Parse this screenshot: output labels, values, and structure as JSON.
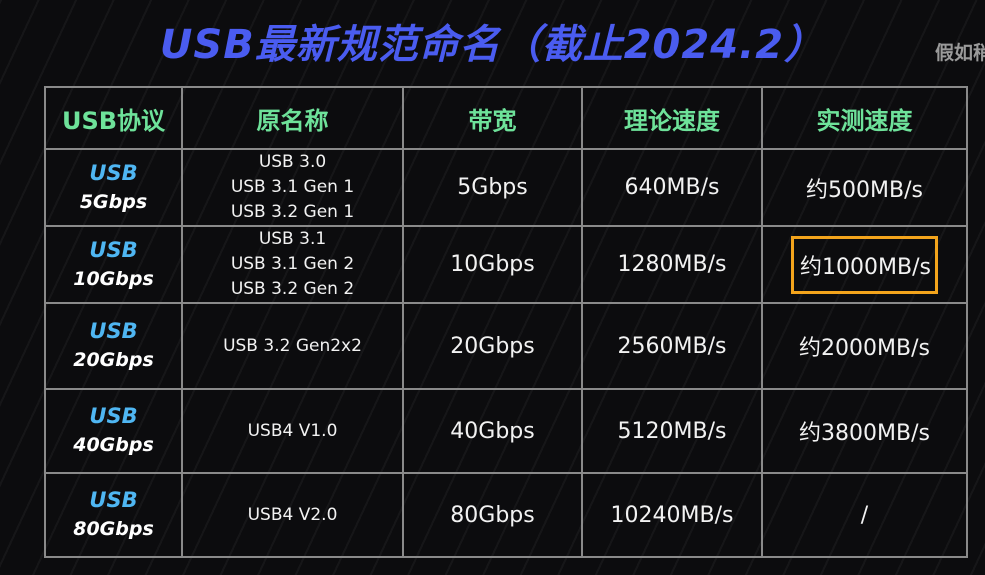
{
  "title": "USB最新规范命名（截止2024.2）",
  "corner_text": "假如稍",
  "colors": {
    "title": "#4a5cf0",
    "header": "#6ee29a",
    "protocol_top": "#4fb6f2",
    "highlight_border": "#f3a41c"
  },
  "headers": [
    "USB协议",
    "原名称",
    "带宽",
    "理论速度",
    "实测速度"
  ],
  "rows": [
    {
      "protocol": [
        "USB",
        "5Gbps"
      ],
      "names": [
        "USB 3.0",
        "USB 3.1 Gen 1",
        "USB 3.2 Gen 1"
      ],
      "bandwidth": "5Gbps",
      "theoretical": "640MB/s",
      "measured": "约500MB/s"
    },
    {
      "protocol": [
        "USB",
        "10Gbps"
      ],
      "names": [
        "USB 3.1",
        "USB 3.1 Gen 2",
        "USB 3.2 Gen 2"
      ],
      "bandwidth": "10Gbps",
      "theoretical": "1280MB/s",
      "measured": "约1000MB/s"
    },
    {
      "protocol": [
        "USB",
        "20Gbps"
      ],
      "names": [
        "USB 3.2 Gen2x2"
      ],
      "bandwidth": "20Gbps",
      "theoretical": "2560MB/s",
      "measured": "约2000MB/s"
    },
    {
      "protocol": [
        "USB",
        "40Gbps"
      ],
      "names": [
        "USB4 V1.0"
      ],
      "bandwidth": "40Gbps",
      "theoretical": "5120MB/s",
      "measured": "约3800MB/s"
    },
    {
      "protocol": [
        "USB",
        "80Gbps"
      ],
      "names": [
        "USB4 V2.0"
      ],
      "bandwidth": "80Gbps",
      "theoretical": "10240MB/s",
      "measured": "/"
    }
  ]
}
